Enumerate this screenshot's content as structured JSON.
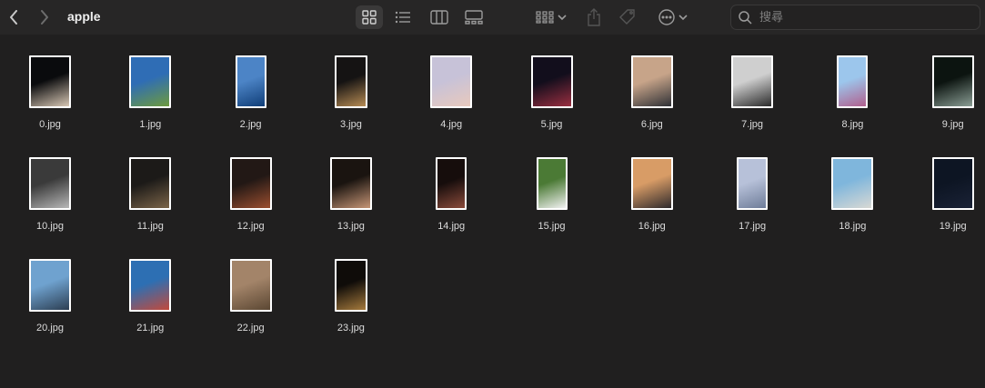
{
  "window": {
    "title": "apple"
  },
  "toolbar": {
    "back_icon": "chevron-left-icon",
    "forward_icon": "chevron-right-icon",
    "view_modes": [
      "icon-view",
      "list-view",
      "column-view",
      "gallery-view"
    ],
    "active_view": "icon-view",
    "search": {
      "placeholder": "搜尋",
      "value": ""
    }
  },
  "files": [
    {
      "name": "0.jpg",
      "colors": [
        "#0a0b0d",
        "#d8c7b4"
      ]
    },
    {
      "name": "1.jpg",
      "colors": [
        "#2f6db5",
        "#6d9a3e"
      ]
    },
    {
      "name": "2.jpg",
      "colors": [
        "#4c84c6",
        "#103e78"
      ]
    },
    {
      "name": "3.jpg",
      "colors": [
        "#151313",
        "#b68b53"
      ]
    },
    {
      "name": "4.jpg",
      "colors": [
        "#c7c2d8",
        "#e8c9bd"
      ]
    },
    {
      "name": "5.jpg",
      "colors": [
        "#120e1c",
        "#9a2e40"
      ]
    },
    {
      "name": "6.jpg",
      "colors": [
        "#c7a489",
        "#2f3136"
      ]
    },
    {
      "name": "7.jpg",
      "colors": [
        "#cfcfcf",
        "#2a2a2a"
      ]
    },
    {
      "name": "8.jpg",
      "colors": [
        "#9cc6ec",
        "#b1608e"
      ]
    },
    {
      "name": "9.jpg",
      "colors": [
        "#0c1410",
        "#8a9d94"
      ]
    },
    {
      "name": "10.jpg",
      "colors": [
        "#3a3a3a",
        "#b7b7b7"
      ]
    },
    {
      "name": "11.jpg",
      "colors": [
        "#1c1a18",
        "#7b6448"
      ]
    },
    {
      "name": "12.jpg",
      "colors": [
        "#221815",
        "#9b4e2f"
      ]
    },
    {
      "name": "13.jpg",
      "colors": [
        "#1a1410",
        "#c69576"
      ]
    },
    {
      "name": "14.jpg",
      "colors": [
        "#160d0c",
        "#8a4a3a"
      ]
    },
    {
      "name": "15.jpg",
      "colors": [
        "#4b7a35",
        "#f2f2f2"
      ]
    },
    {
      "name": "16.jpg",
      "colors": [
        "#d89c66",
        "#2e2a2c"
      ]
    },
    {
      "name": "17.jpg",
      "colors": [
        "#b7c1d9",
        "#6f7d99"
      ]
    },
    {
      "name": "18.jpg",
      "colors": [
        "#7fb6dc",
        "#d8d8d4"
      ]
    },
    {
      "name": "19.jpg",
      "colors": [
        "#0d1523",
        "#1a2236"
      ]
    },
    {
      "name": "20.jpg",
      "colors": [
        "#6fa2cf",
        "#2c3e52"
      ]
    },
    {
      "name": "21.jpg",
      "colors": [
        "#2d6fb3",
        "#c24a3c"
      ]
    },
    {
      "name": "22.jpg",
      "colors": [
        "#a38469",
        "#5b4733"
      ]
    },
    {
      "name": "23.jpg",
      "colors": [
        "#0f0c09",
        "#a57a3c"
      ]
    }
  ]
}
